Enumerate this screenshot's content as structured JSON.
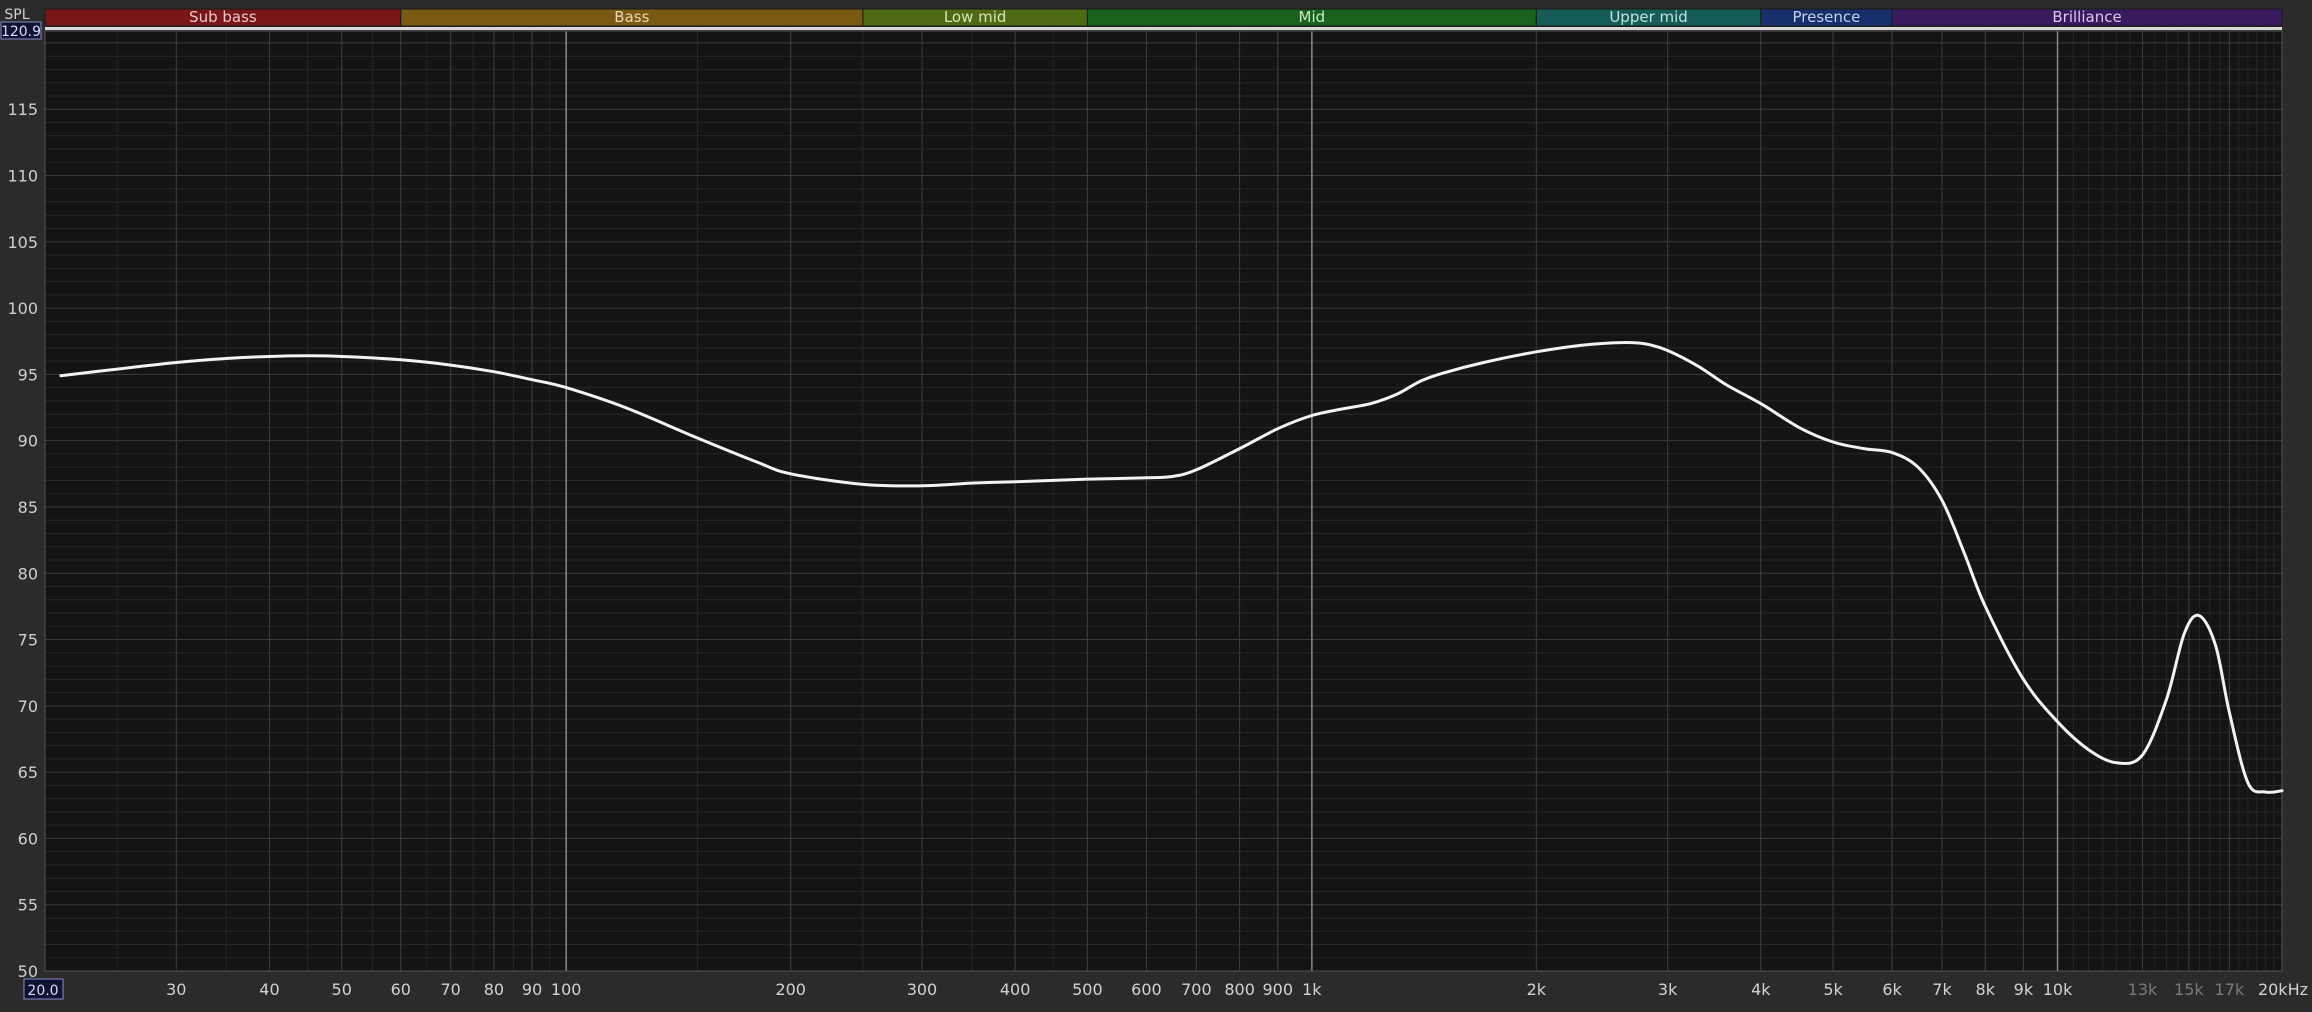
{
  "chart_data": {
    "type": "line",
    "title": "",
    "xlabel": "",
    "ylabel": "SPL",
    "x_scale": "log",
    "xlim": [
      20,
      20000
    ],
    "ylim": [
      50,
      120.9
    ],
    "y_max_readout": "120.9",
    "x_min_readout": "20.0",
    "grid": true,
    "y_ticks": [
      50,
      55,
      60,
      65,
      70,
      75,
      80,
      85,
      90,
      95,
      100,
      105,
      110,
      115,
      120
    ],
    "x_ticks": [
      {
        "v": 30,
        "label": "30",
        "dim": false
      },
      {
        "v": 40,
        "label": "40",
        "dim": false
      },
      {
        "v": 50,
        "label": "50",
        "dim": false
      },
      {
        "v": 60,
        "label": "60",
        "dim": false
      },
      {
        "v": 70,
        "label": "70",
        "dim": false
      },
      {
        "v": 80,
        "label": "80",
        "dim": false
      },
      {
        "v": 90,
        "label": "90",
        "dim": false
      },
      {
        "v": 100,
        "label": "100",
        "dim": false
      },
      {
        "v": 200,
        "label": "200",
        "dim": false
      },
      {
        "v": 300,
        "label": "300",
        "dim": false
      },
      {
        "v": 400,
        "label": "400",
        "dim": false
      },
      {
        "v": 500,
        "label": "500",
        "dim": false
      },
      {
        "v": 600,
        "label": "600",
        "dim": false
      },
      {
        "v": 700,
        "label": "700",
        "dim": false
      },
      {
        "v": 800,
        "label": "800",
        "dim": false
      },
      {
        "v": 900,
        "label": "900",
        "dim": false
      },
      {
        "v": 1000,
        "label": "1k",
        "dim": false
      },
      {
        "v": 2000,
        "label": "2k",
        "dim": false
      },
      {
        "v": 3000,
        "label": "3k",
        "dim": false
      },
      {
        "v": 4000,
        "label": "4k",
        "dim": false
      },
      {
        "v": 5000,
        "label": "5k",
        "dim": false
      },
      {
        "v": 6000,
        "label": "6k",
        "dim": false
      },
      {
        "v": 7000,
        "label": "7k",
        "dim": false
      },
      {
        "v": 8000,
        "label": "8k",
        "dim": false
      },
      {
        "v": 9000,
        "label": "9k",
        "dim": false
      },
      {
        "v": 10000,
        "label": "10k",
        "dim": false
      },
      {
        "v": 13000,
        "label": "13k",
        "dim": true
      },
      {
        "v": 15000,
        "label": "15k",
        "dim": true
      },
      {
        "v": 17000,
        "label": "17k",
        "dim": true
      },
      {
        "v": 20000,
        "label": "20kHz",
        "dim": false
      }
    ],
    "bands": [
      {
        "name": "Sub bass",
        "from": 20,
        "to": 60,
        "color": "#7a1518",
        "text": "#e8c9c9"
      },
      {
        "name": "Bass",
        "from": 60,
        "to": 250,
        "color": "#7a5a12",
        "text": "#ead8b0"
      },
      {
        "name": "Low mid",
        "from": 250,
        "to": 500,
        "color": "#4f6a14",
        "text": "#d6e6b4"
      },
      {
        "name": "Mid",
        "from": 500,
        "to": 2000,
        "color": "#18621e",
        "text": "#c8e8c8"
      },
      {
        "name": "Upper mid",
        "from": 2000,
        "to": 4000,
        "color": "#145c55",
        "text": "#bfe3df"
      },
      {
        "name": "Presence",
        "from": 4000,
        "to": 6000,
        "color": "#17306b",
        "text": "#c4d0ee"
      },
      {
        "name": "Brilliance",
        "from": 6000,
        "to": 20000,
        "color": "#3a1a5e",
        "text": "#d9c8ee"
      }
    ],
    "series": [
      {
        "color": "#f2f2f2",
        "x": [
          21,
          25,
          30,
          35,
          40,
          45,
          50,
          60,
          70,
          80,
          90,
          100,
          120,
          150,
          180,
          200,
          250,
          300,
          350,
          400,
          450,
          500,
          550,
          600,
          650,
          700,
          800,
          900,
          1000,
          1100,
          1200,
          1300,
          1400,
          1500,
          1700,
          2000,
          2300,
          2600,
          2800,
          3000,
          3300,
          3600,
          4000,
          4500,
          5000,
          5500,
          6000,
          6500,
          7000,
          7500,
          8000,
          9000,
          10000,
          11000,
          12000,
          13000,
          14000,
          14800,
          15500,
          16300,
          17000,
          18000,
          19000,
          20000
        ],
        "y": [
          94.9,
          95.4,
          95.9,
          96.2,
          96.35,
          96.4,
          96.35,
          96.1,
          95.7,
          95.2,
          94.6,
          94.0,
          92.5,
          90.2,
          88.4,
          87.5,
          86.7,
          86.6,
          86.8,
          86.9,
          87.0,
          87.1,
          87.15,
          87.2,
          87.3,
          87.8,
          89.4,
          90.9,
          91.9,
          92.4,
          92.8,
          93.5,
          94.5,
          95.1,
          95.9,
          96.7,
          97.2,
          97.4,
          97.3,
          96.8,
          95.6,
          94.2,
          92.8,
          91.0,
          89.9,
          89.4,
          89.1,
          88.0,
          85.5,
          81.5,
          77.5,
          72.0,
          68.8,
          66.7,
          65.7,
          66.3,
          70.5,
          75.5,
          76.8,
          74.5,
          69.5,
          64.2,
          63.5,
          63.6
        ]
      }
    ]
  }
}
